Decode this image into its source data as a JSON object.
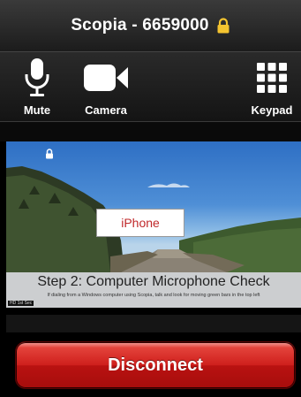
{
  "header": {
    "title": "Scopia - 6659000",
    "lock_icon": "lock-icon",
    "lock_color": "#f4c430"
  },
  "toolbar": {
    "mute_label": "Mute",
    "camera_label": "Camera",
    "keypad_label": "Keypad"
  },
  "video": {
    "device_label": "iPhone",
    "caption_title": "Step 2: Computer Microphone Check",
    "caption_subtitle": "If dialing from a Windows computer using Scopia, talk and look for moving green bars in the top left",
    "corner_tag": "HD 1st Sec"
  },
  "actions": {
    "disconnect_label": "Disconnect",
    "disconnect_color": "#cf1f1c"
  }
}
